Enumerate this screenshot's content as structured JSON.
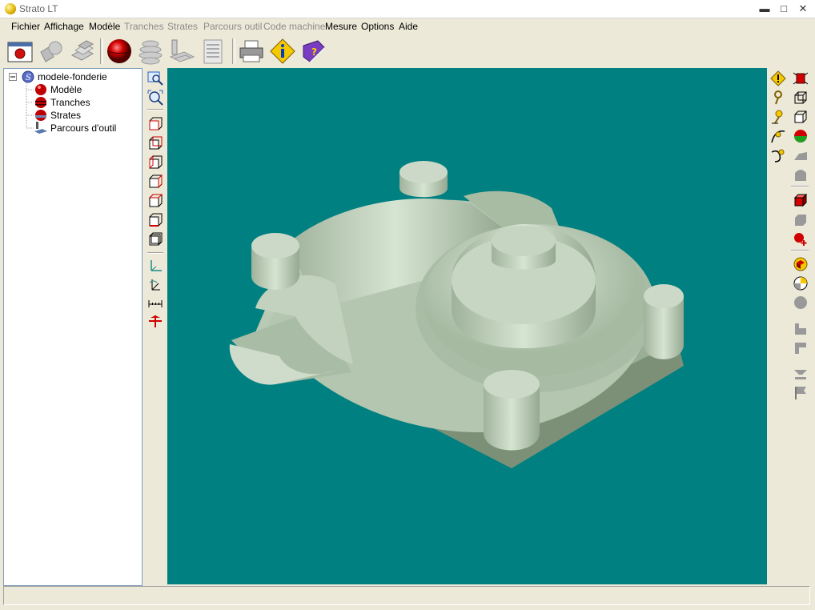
{
  "window": {
    "title": "Strato LT",
    "minimize": "▬",
    "maximize": "□",
    "close": "✕"
  },
  "menu": [
    {
      "label": "Fichier",
      "enabled": true
    },
    {
      "label": "Affichage",
      "enabled": true
    },
    {
      "label": "Modèle",
      "enabled": true
    },
    {
      "label": "Tranches",
      "enabled": false
    },
    {
      "label": "Strates",
      "enabled": false
    },
    {
      "label": "Parcours outil",
      "enabled": false
    },
    {
      "label": "Code machine",
      "enabled": false
    },
    {
      "label": "Mesure",
      "enabled": true
    },
    {
      "label": "Options",
      "enabled": true
    },
    {
      "label": "Aide",
      "enabled": true
    }
  ],
  "toolbar": {
    "icons": [
      "open-window-icon",
      "shapes-icon",
      "layers-icon",
      "red-sphere-icon",
      "slices-icon",
      "toolpath-icon",
      "gcode-sheet-icon",
      "printer-icon",
      "info-icon",
      "help-book-icon"
    ]
  },
  "tree": {
    "root": "modele-fonderie",
    "items": [
      "Modèle",
      "Tranches",
      "Strates",
      "Parcours d'outil"
    ]
  },
  "viewport": {
    "background": "#008080",
    "model_color": "#b8ccb4"
  },
  "left_tools": [
    "zoom-window-icon",
    "zoom-fit-icon",
    "view-front-icon",
    "view-back-icon",
    "view-left-icon",
    "view-right-icon",
    "view-top-icon",
    "view-bottom-icon",
    "view-iso-icon",
    "axes-icon",
    "axes-rotate-icon",
    "measure-icon",
    "section-icon"
  ],
  "right_tools_col1": [
    "warning-icon",
    "key-icon",
    "key-move-icon",
    "curve-icon",
    "curve-select-icon"
  ],
  "right_tools_col2": [
    "bug-icon",
    "wireframe-icon",
    "box-icon",
    "shaded-sphere-icon",
    "surface-icon",
    "dome-icon",
    "red-cube-icon",
    "flat-box-icon",
    "add-point-icon",
    "cube-cut-icon",
    "cylinder-cut-icon",
    "disc-icon",
    "step-icon",
    "step-down-icon",
    "funnel-icon",
    "flag-icon"
  ],
  "status": {
    "text": ""
  }
}
